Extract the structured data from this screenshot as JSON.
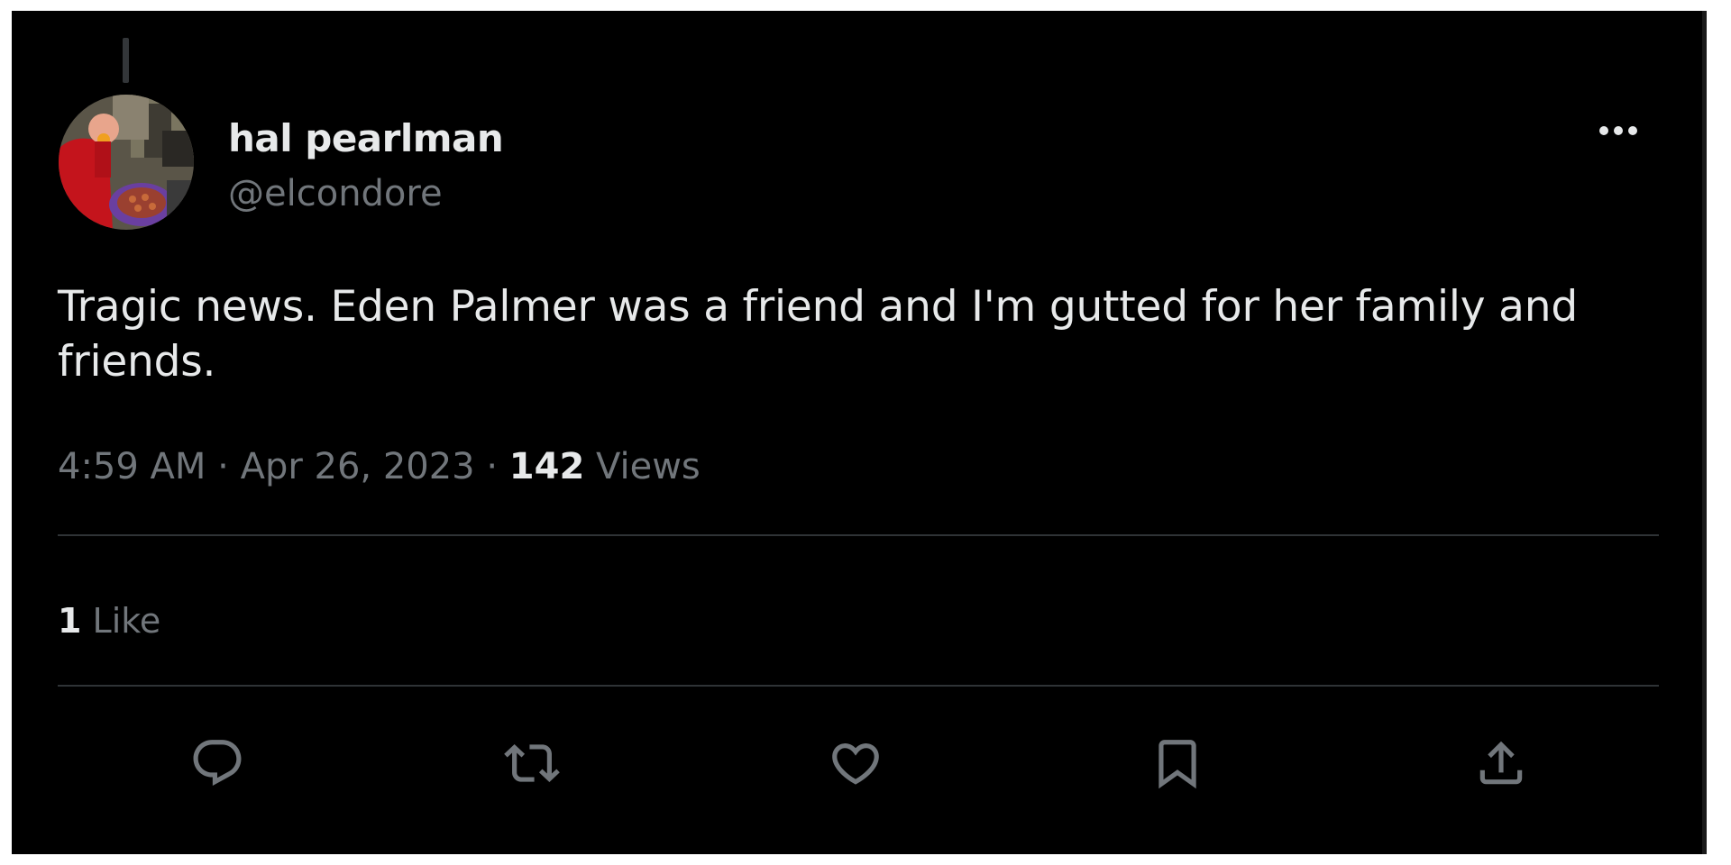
{
  "tweet": {
    "author": {
      "display_name": "hal pearlman",
      "handle": "@elcondore"
    },
    "text": "Tragic news. Eden Palmer was a friend and I'm gutted for her family and friends.",
    "time": "4:59 AM",
    "separator": "·",
    "date": "Apr 26, 2023",
    "views_count": "142",
    "views_label": "Views",
    "like_count": "1",
    "like_label": "Like"
  },
  "icons": {
    "more": "more-horizontal-icon",
    "reply": "speech-bubble-icon",
    "retweet": "retweet-arrows-icon",
    "like": "heart-icon",
    "bookmark": "bookmark-icon",
    "share": "upload-arrow-icon"
  },
  "colors": {
    "background": "#000000",
    "primary_text": "#e7e9ea",
    "secondary_text": "#71767b",
    "divider": "#2f3336"
  }
}
